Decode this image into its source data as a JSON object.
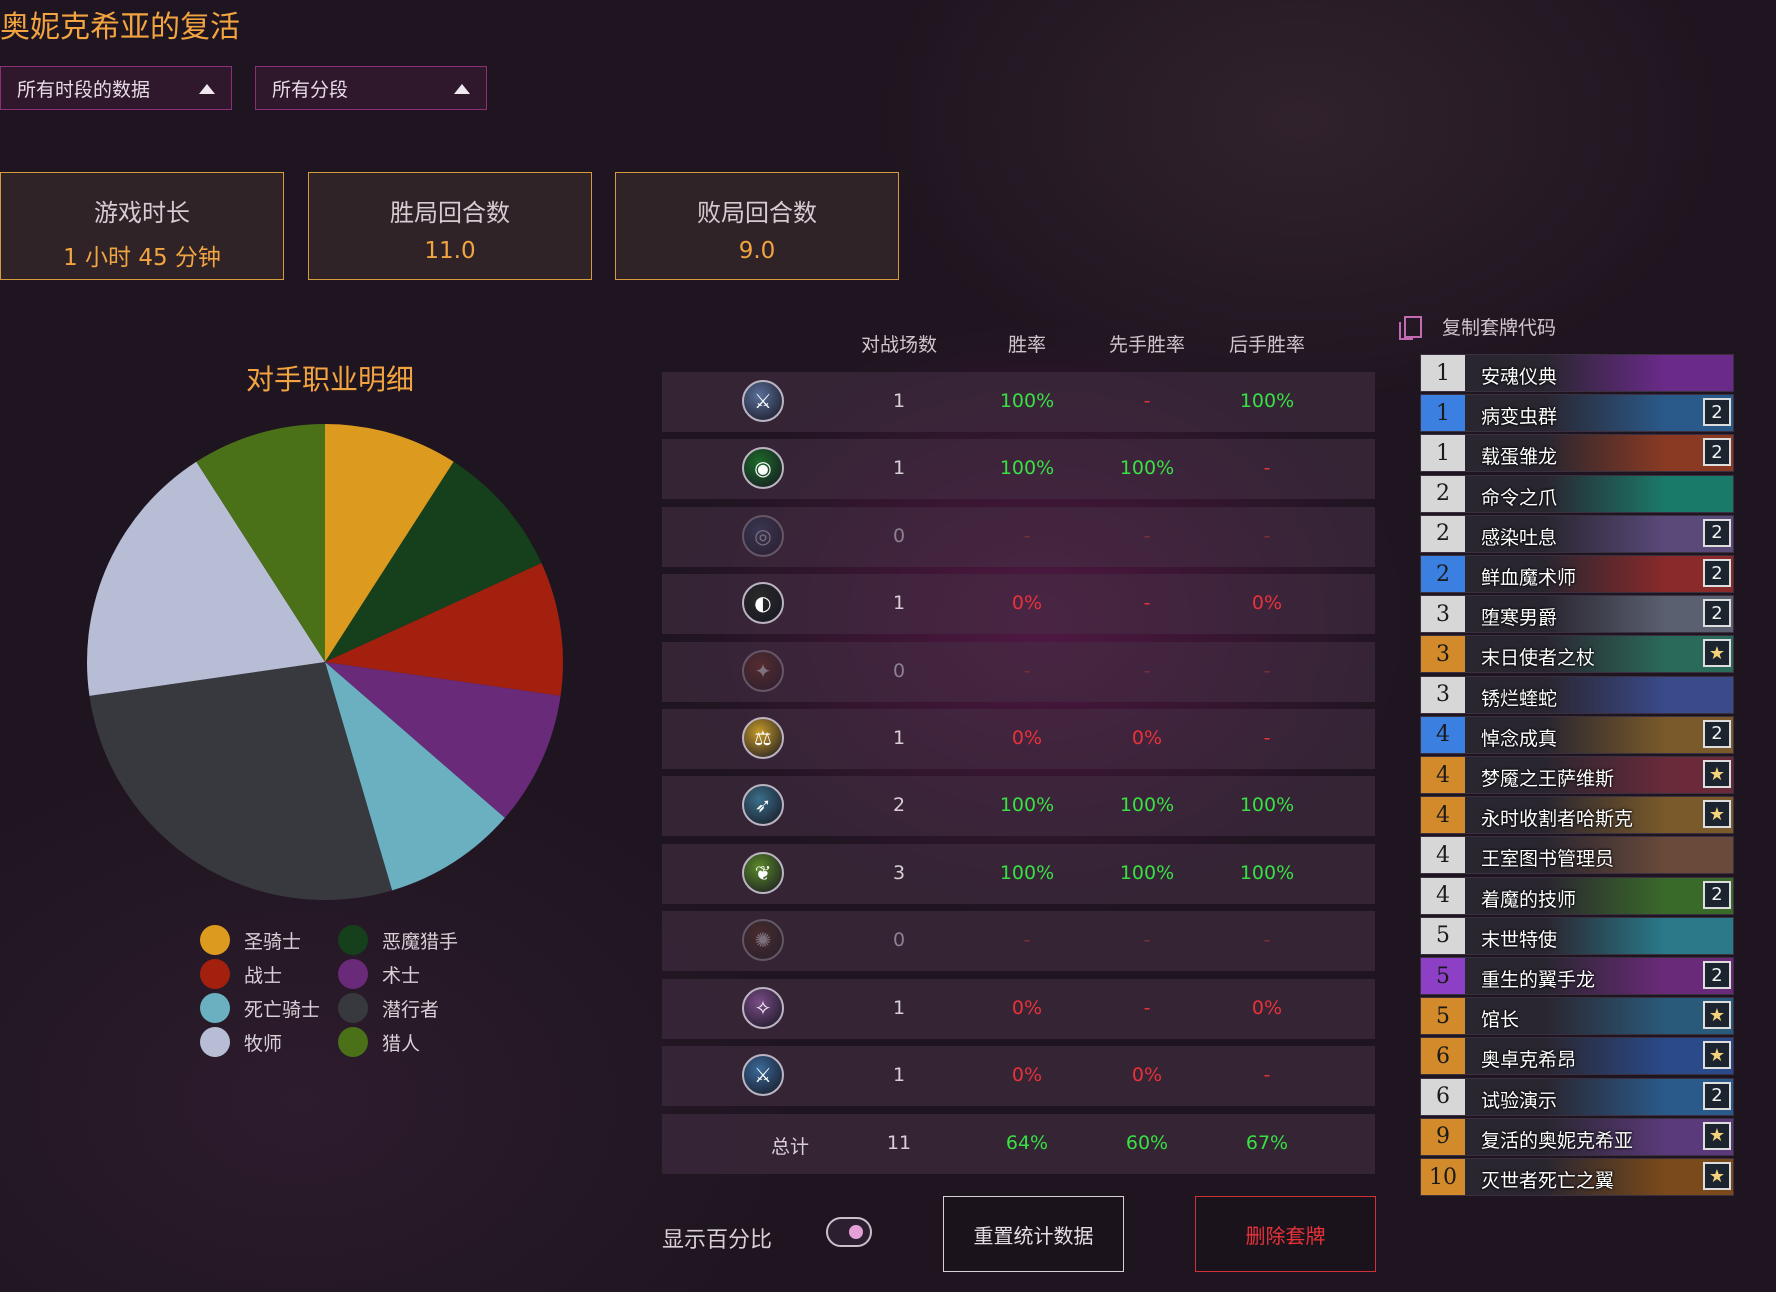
{
  "header": {
    "title": "奥妮克希亚的复活",
    "time_filter": "所有时段的数据",
    "rank_filter": "所有分段"
  },
  "stats": [
    {
      "label": "游戏时长",
      "value": "1 小时 45 分钟"
    },
    {
      "label": "胜局回合数",
      "value": "11.0"
    },
    {
      "label": "败局回合数",
      "value": "9.0"
    }
  ],
  "chart_data": {
    "type": "pie",
    "title": "对手职业明细",
    "slices": [
      {
        "name": "圣骑士",
        "value": 1,
        "color": "#dc9a1e"
      },
      {
        "name": "恶魔猎手",
        "value": 1,
        "color": "#15401b"
      },
      {
        "name": "战士",
        "value": 1,
        "color": "#a3200f"
      },
      {
        "name": "术士",
        "value": 1,
        "color": "#6a2a7a"
      },
      {
        "name": "死亡骑士",
        "value": 1,
        "color": "#6ab0c0"
      },
      {
        "name": "潜行者",
        "value": 3,
        "color": "#38393e"
      },
      {
        "name": "牧师",
        "value": 2,
        "color": "#b8bdd6"
      },
      {
        "name": "猎人",
        "value": 1,
        "color": "#4a7018"
      }
    ]
  },
  "legend": [
    {
      "name": "圣骑士",
      "color": "#dc9a1e"
    },
    {
      "name": "恶魔猎手",
      "color": "#15401b"
    },
    {
      "name": "战士",
      "color": "#a3200f"
    },
    {
      "name": "术士",
      "color": "#6a2a7a"
    },
    {
      "name": "死亡骑士",
      "color": "#6ab0c0"
    },
    {
      "name": "潜行者",
      "color": "#38393e"
    },
    {
      "name": "牧师",
      "color": "#b8bdd6"
    },
    {
      "name": "猎人",
      "color": "#4a7018"
    }
  ],
  "table": {
    "headers": [
      "对战场数",
      "胜率",
      "先手胜率",
      "后手胜率"
    ],
    "rows": [
      {
        "icon": "warrior-class-icon",
        "color": "#5a6f9a",
        "glyph": "⚔",
        "games": "1",
        "wr": "100%",
        "first": "-",
        "second": "100%",
        "dim": false
      },
      {
        "icon": "demon-hunter-class-icon",
        "color": "#1d6b2a",
        "glyph": "◉",
        "games": "1",
        "wr": "100%",
        "first": "100%",
        "second": "-",
        "dim": false
      },
      {
        "icon": "shaman-class-icon",
        "color": "#3b5a86",
        "glyph": "◎",
        "games": "0",
        "wr": "-",
        "first": "-",
        "second": "-",
        "dim": true
      },
      {
        "icon": "rogue-class-icon",
        "color": "#2b2b2b",
        "glyph": "◐",
        "games": "1",
        "wr": "0%",
        "first": "-",
        "second": "0%",
        "dim": false
      },
      {
        "icon": "mage-class-icon",
        "color": "#8a3b22",
        "glyph": "✦",
        "games": "0",
        "wr": "-",
        "first": "-",
        "second": "-",
        "dim": true
      },
      {
        "icon": "paladin-class-icon",
        "color": "#c79a2a",
        "glyph": "⚖",
        "games": "1",
        "wr": "0%",
        "first": "0%",
        "second": "-",
        "dim": false
      },
      {
        "icon": "hunter-class-icon",
        "color": "#3b6f8a",
        "glyph": "➶",
        "games": "2",
        "wr": "100%",
        "first": "100%",
        "second": "100%",
        "dim": false
      },
      {
        "icon": "druid-class-icon",
        "color": "#5b8a2a",
        "glyph": "❦",
        "games": "3",
        "wr": "100%",
        "first": "100%",
        "second": "100%",
        "dim": false
      },
      {
        "icon": "warlock-class-icon",
        "color": "#6b3b22",
        "glyph": "✺",
        "games": "0",
        "wr": "-",
        "first": "-",
        "second": "-",
        "dim": true
      },
      {
        "icon": "priest-class-icon",
        "color": "#7a4c86",
        "glyph": "✧",
        "games": "1",
        "wr": "0%",
        "first": "-",
        "second": "0%",
        "dim": false
      },
      {
        "icon": "death-knight-class-icon",
        "color": "#3b6a9a",
        "glyph": "⚔",
        "games": "1",
        "wr": "0%",
        "first": "0%",
        "second": "-",
        "dim": false
      }
    ],
    "total": {
      "label": "总计",
      "games": "11",
      "wr": "64%",
      "first": "60%",
      "second": "67%"
    }
  },
  "controls": {
    "show_percent_label": "显示百分比",
    "show_percent_on": true,
    "reset_label": "重置统计数据",
    "delete_label": "删除套牌"
  },
  "deck": {
    "copy_label": "复制套牌代码",
    "cards": [
      {
        "cost": "1",
        "name": "安魂仪典",
        "rarity": "common",
        "count": "",
        "art": "#6a2a8a"
      },
      {
        "cost": "1",
        "name": "病变虫群",
        "rarity": "rare",
        "count": "2",
        "art": "#2a5a8a"
      },
      {
        "cost": "1",
        "name": "载蛋雏龙",
        "rarity": "common",
        "count": "2",
        "art": "#8a3a22"
      },
      {
        "cost": "2",
        "name": "命令之爪",
        "rarity": "common",
        "count": "",
        "art": "#1a7a6a"
      },
      {
        "cost": "2",
        "name": "感染吐息",
        "rarity": "common",
        "count": "2",
        "art": "#5a4a7a"
      },
      {
        "cost": "2",
        "name": "鲜血魔术师",
        "rarity": "rare",
        "count": "2",
        "art": "#8a2a2a"
      },
      {
        "cost": "3",
        "name": "堕寒男爵",
        "rarity": "common",
        "count": "2",
        "art": "#5a6070"
      },
      {
        "cost": "3",
        "name": "末日使者之杖",
        "rarity": "legend",
        "count": "★",
        "art": "#2a6a5a"
      },
      {
        "cost": "3",
        "name": "锈烂蝰蛇",
        "rarity": "common",
        "count": "",
        "art": "#3a4a8a"
      },
      {
        "cost": "4",
        "name": "悼念成真",
        "rarity": "rare",
        "count": "2",
        "art": "#7a5a2a"
      },
      {
        "cost": "4",
        "name": "梦魇之王萨维斯",
        "rarity": "legend",
        "count": "★",
        "art": "#6a2a3a"
      },
      {
        "cost": "4",
        "name": "永时收割者哈斯克",
        "rarity": "legend",
        "count": "★",
        "art": "#7a5a2a"
      },
      {
        "cost": "4",
        "name": "王室图书管理员",
        "rarity": "common",
        "count": "",
        "art": "#6a4a3a"
      },
      {
        "cost": "4",
        "name": "着魔的技师",
        "rarity": "common",
        "count": "2",
        "art": "#3a6a2a"
      },
      {
        "cost": "5",
        "name": "末世特使",
        "rarity": "common",
        "count": "",
        "art": "#2a7a8a"
      },
      {
        "cost": "5",
        "name": "重生的翼手龙",
        "rarity": "epic",
        "count": "2",
        "art": "#6a2a7a"
      },
      {
        "cost": "5",
        "name": "馆长",
        "rarity": "legend",
        "count": "★",
        "art": "#2a5a7a"
      },
      {
        "cost": "6",
        "name": "奥卓克希昂",
        "rarity": "legend",
        "count": "★",
        "art": "#2a4a8a"
      },
      {
        "cost": "6",
        "name": "试验演示",
        "rarity": "common",
        "count": "2",
        "art": "#2a5a8a"
      },
      {
        "cost": "9",
        "name": "复活的奥妮克希亚",
        "rarity": "legend",
        "count": "★",
        "art": "#5a3a7a"
      },
      {
        "cost": "10",
        "name": "灭世者死亡之翼",
        "rarity": "legend",
        "count": "★",
        "art": "#7a4a1a"
      }
    ]
  }
}
